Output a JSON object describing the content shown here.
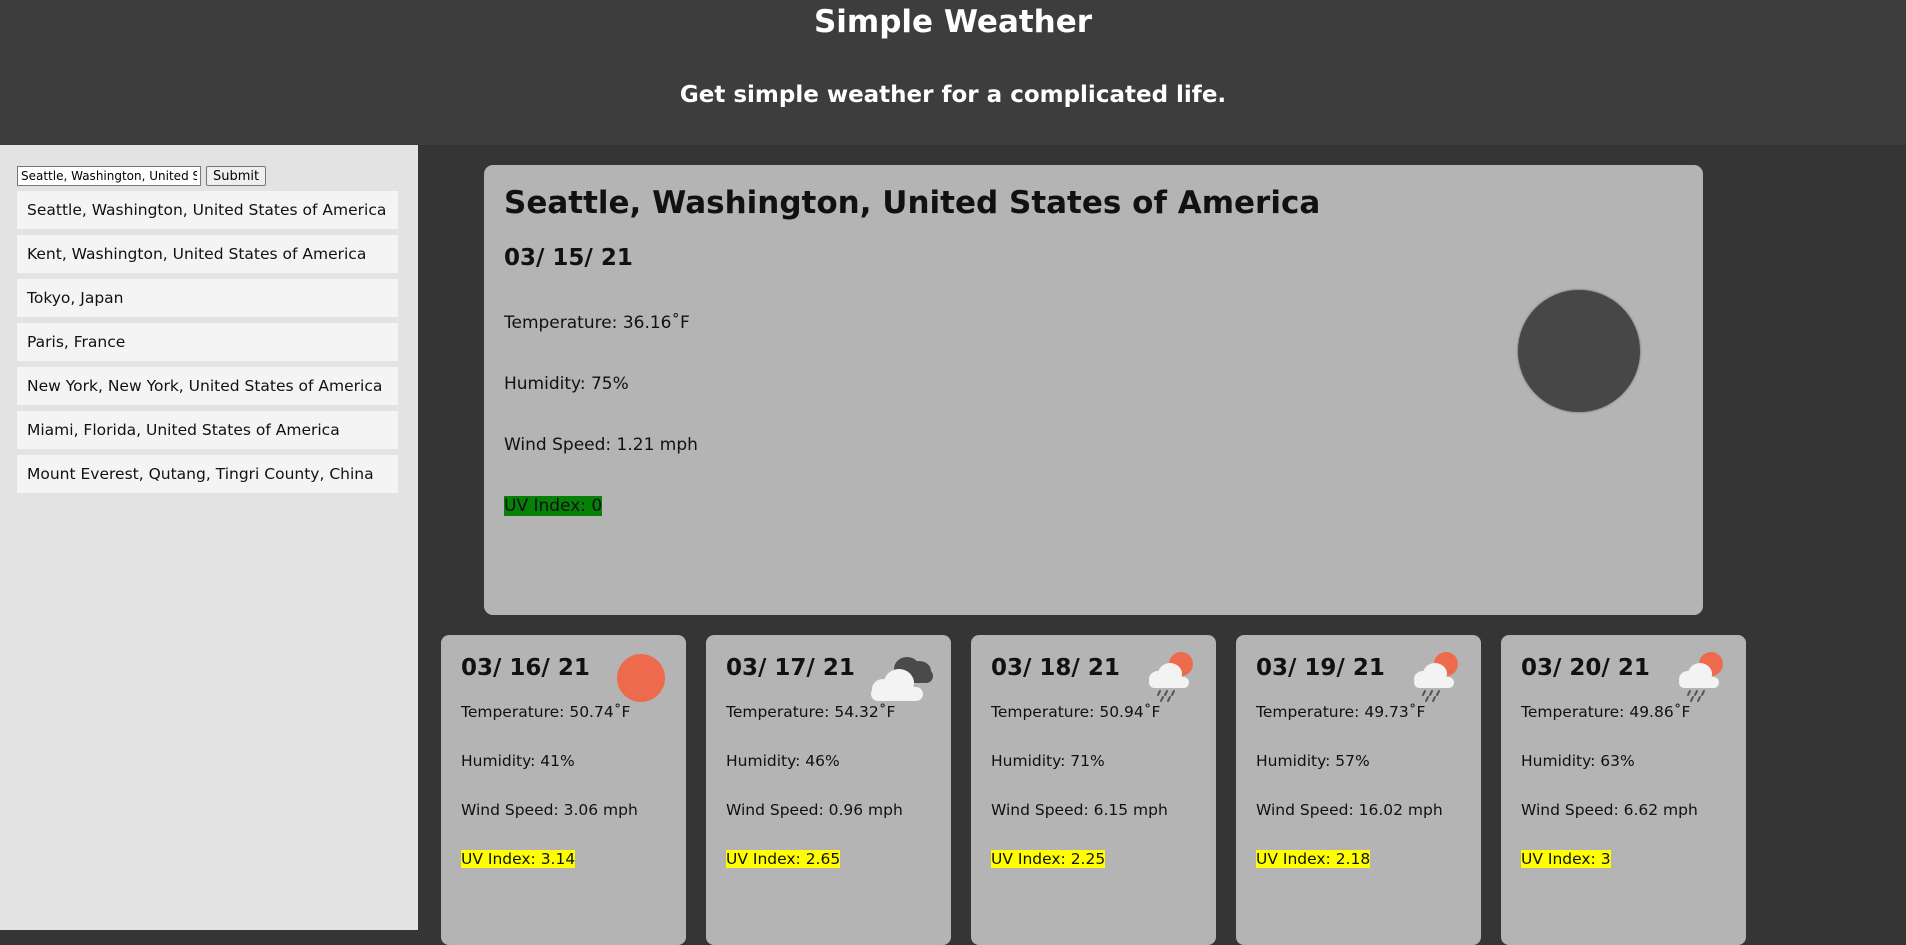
{
  "header": {
    "title": "Simple Weather",
    "subtitle": "Get simple weather for a complicated life."
  },
  "search": {
    "value": "Seattle, Washington, United States of America",
    "submit_label": "Submit"
  },
  "history": [
    "Seattle, Washington, United States of America",
    "Kent, Washington, United States of America",
    "Tokyo, Japan",
    "Paris, France",
    "New York, New York, United States of America",
    "Miami, Florida, United States of America",
    "Mount Everest, Qutang, Tingri County, China"
  ],
  "current": {
    "city": "Seattle, Washington, United States of America",
    "date": "03/ 15/ 21",
    "temperature": "Temperature: 36.16˚F",
    "humidity": "Humidity: 75%",
    "wind": "Wind Speed: 1.21 mph",
    "uv": "UV Index: 0",
    "icon": "moon-icon"
  },
  "forecast": [
    {
      "date": "03/ 16/ 21",
      "temperature": "Temperature: 50.74˚F",
      "humidity": "Humidity: 41%",
      "wind": "Wind Speed: 3.06 mph",
      "uv": "UV Index: 3.14",
      "icon": "sun-icon"
    },
    {
      "date": "03/ 17/ 21",
      "temperature": "Temperature: 54.32˚F",
      "humidity": "Humidity: 46%",
      "wind": "Wind Speed: 0.96 mph",
      "uv": "UV Index: 2.65",
      "icon": "cloudy-icon"
    },
    {
      "date": "03/ 18/ 21",
      "temperature": "Temperature: 50.94˚F",
      "humidity": "Humidity: 71%",
      "wind": "Wind Speed: 6.15 mph",
      "uv": "UV Index: 2.25",
      "icon": "rain-sun-icon"
    },
    {
      "date": "03/ 19/ 21",
      "temperature": "Temperature: 49.73˚F",
      "humidity": "Humidity: 57%",
      "wind": "Wind Speed: 16.02 mph",
      "uv": "UV Index: 2.18",
      "icon": "rain-sun-icon"
    },
    {
      "date": "03/ 20/ 21",
      "temperature": "Temperature: 49.86˚F",
      "humidity": "Humidity: 63%",
      "wind": "Wind Speed: 6.62 mph",
      "uv": "UV Index: 3",
      "icon": "rain-sun-icon"
    }
  ],
  "colors": {
    "uv_low": "#078007",
    "uv_moderate": "#ffff00",
    "sun": "#ee6a4c"
  }
}
